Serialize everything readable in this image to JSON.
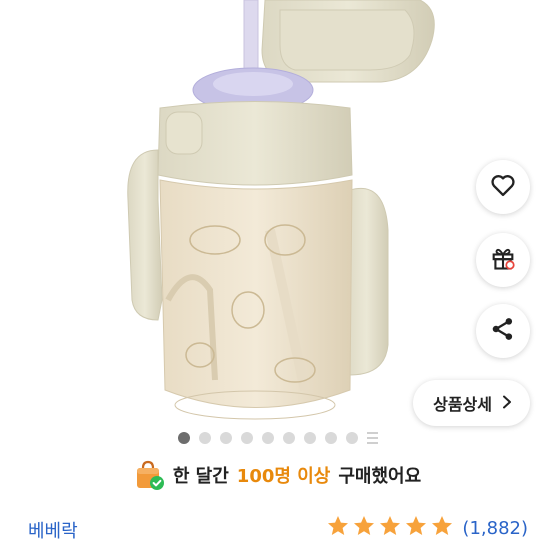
{
  "actions": {
    "like": "heart-icon",
    "gift": "gift-icon",
    "share": "share-icon"
  },
  "detail_button": {
    "label": "상품상세"
  },
  "carousel": {
    "total_slides": 10,
    "active_index": 0
  },
  "promo": {
    "prefix": "한 달간",
    "highlight": "100명 이상",
    "suffix": "구매했어요"
  },
  "seller": {
    "name": "베베락"
  },
  "rating": {
    "stars": 5,
    "count_text": "(1,882)",
    "star_color": "#f7a23b"
  }
}
